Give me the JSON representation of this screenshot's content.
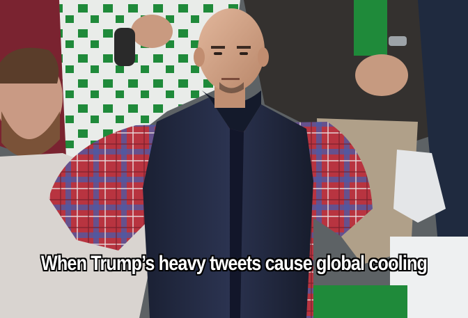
{
  "meme": {
    "caption": "When Trump’s heavy tweets cause global cooling"
  },
  "colors": {
    "jersey_green": "#1f8a3a",
    "vest_navy": "#20263d",
    "shirt_red": "#b8323c",
    "shirt_blue": "#4a5aa8",
    "skin": "#d2a285",
    "caption_fill": "#ffffff",
    "caption_outline": "#000000"
  }
}
